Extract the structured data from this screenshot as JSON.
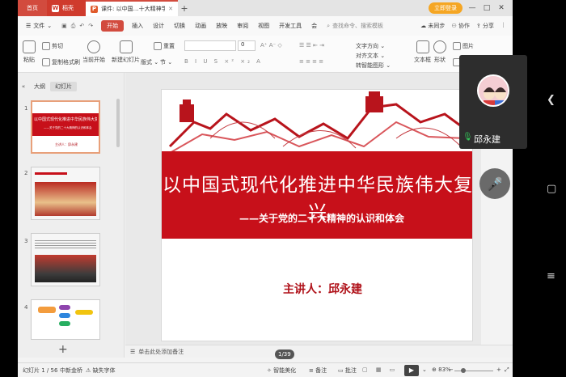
{
  "titlebar": {
    "home_tab": "首页",
    "wps_tab": "稻壳",
    "doc_tab": "课件: 以中国…十大精神学习",
    "login_button": "立即登录",
    "minimize": "—",
    "maximize": "□",
    "close": "✕"
  },
  "menubar": {
    "file": "文件",
    "start": "开始",
    "insert": "插入",
    "design": "设计",
    "switch": "切换",
    "animation": "动画",
    "show": "放映",
    "review": "审阅",
    "view": "视图",
    "dev": "开发工具",
    "member": "会",
    "search_placeholder": "查找命令、搜索模板",
    "sync": "未同步",
    "collab": "协作",
    "share": "分享"
  },
  "ribbon": {
    "cut": "剪切",
    "copy": "复制",
    "format_painter": "格式刷",
    "paste": "粘贴",
    "play_from_current": "当前开始",
    "new_slide": "新建幻灯片",
    "layout": "版式",
    "section": "节",
    "reset": "重置",
    "font_size_value": "0",
    "textbox": "文本框",
    "shape": "形状",
    "picture": "图片",
    "fill": "填充",
    "convert_smartart": "转智能图形",
    "text_direction": "文字方向",
    "align_text": "对齐文本"
  },
  "leftpanel": {
    "outline_tab": "大纲",
    "slides_tab": "幻灯片",
    "thumb_nums": [
      "1",
      "2",
      "3",
      "4"
    ],
    "thumb1_title": "以中国式现代化推进中华民族伟大复兴",
    "thumb1_sub": "——关于党的二十大精神的认识和体会",
    "thumb1_speaker": "主讲人：邱永建",
    "add_slide": "+"
  },
  "slide": {
    "title": "以中国式现代化推进中华民族伟大复兴",
    "subtitle": "——关于党的二十大精神的认识和体会",
    "speaker": "主讲人：邱永建"
  },
  "notes": {
    "placeholder": "单击此处添加备注",
    "page_indicator": "1/39"
  },
  "statusbar": {
    "slide_count": "幻灯片 1 / 56",
    "theme": "中新金桥",
    "missing_font": "缺失字体",
    "smart_beautify": "智能美化",
    "notes": "备注",
    "comments": "批注",
    "zoom": "83%",
    "play": "▶"
  },
  "overlay": {
    "user_name": "邱永建"
  }
}
